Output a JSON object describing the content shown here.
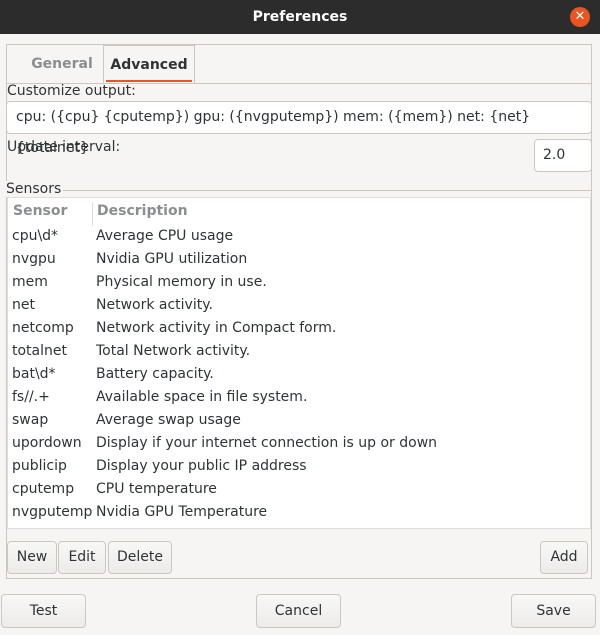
{
  "window": {
    "title": "Preferences"
  },
  "tabs": [
    {
      "label": "General"
    },
    {
      "label": "Advanced"
    }
  ],
  "advanced": {
    "customize_label": "Customize output:",
    "customize_value": "cpu: ({cpu} {cputemp}) gpu: ({nvgputemp}) mem: ({mem}) net: {net} {totalnet}",
    "interval_label": "Update interval:",
    "interval_value": "2.0",
    "sensors_label": "Sensors",
    "columns": {
      "sensor": "Sensor",
      "description": "Description"
    },
    "sensors": [
      {
        "sensor": "cpu\\d*",
        "description": "Average CPU usage"
      },
      {
        "sensor": "nvgpu",
        "description": "Nvidia GPU utilization"
      },
      {
        "sensor": "mem",
        "description": "Physical memory in use."
      },
      {
        "sensor": "net",
        "description": "Network activity."
      },
      {
        "sensor": "netcomp",
        "description": "Network activity in Compact form."
      },
      {
        "sensor": "totalnet",
        "description": "Total Network activity."
      },
      {
        "sensor": "bat\\d*",
        "description": "Battery capacity."
      },
      {
        "sensor": "fs//.+",
        "description": "Available space in file system."
      },
      {
        "sensor": "swap",
        "description": "Average swap usage"
      },
      {
        "sensor": "upordown",
        "description": "Display if your internet connection is up or down"
      },
      {
        "sensor": "publicip",
        "description": "Display your public IP address"
      },
      {
        "sensor": "cputemp",
        "description": "CPU temperature"
      },
      {
        "sensor": "nvgputemp",
        "description": "Nvidia GPU Temperature"
      }
    ],
    "buttons": {
      "new": "New",
      "edit": "Edit",
      "delete": "Delete",
      "add": "Add"
    }
  },
  "footer": {
    "test": "Test",
    "cancel": "Cancel",
    "save": "Save"
  },
  "colors": {
    "accent": "#e95420",
    "titlebar": "#2c2c2c"
  }
}
